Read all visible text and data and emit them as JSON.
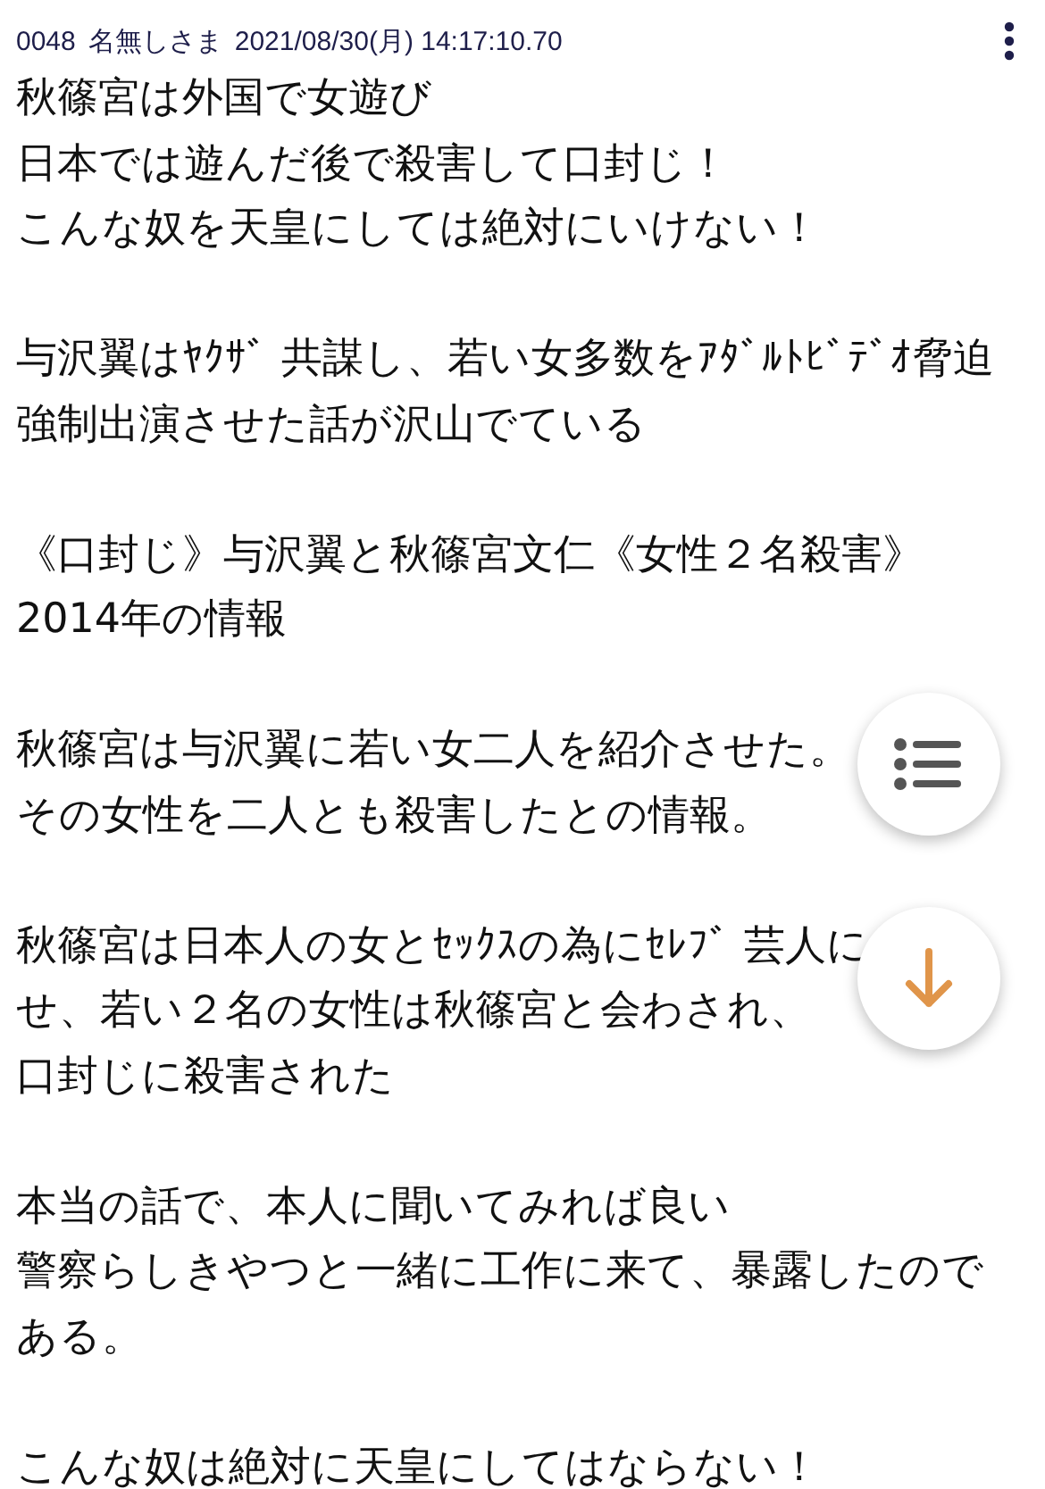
{
  "post": {
    "number": "0048",
    "name": "名無しさま",
    "datetime": "2021/08/30(月) 14:17:10.70",
    "paragraphs": [
      {
        "lines": [
          "秋篠宮は外国で女遊び",
          "日本では遊んだ後で殺害して口封じ！",
          "こんな奴を天皇にしては絶対にいけない！"
        ]
      },
      {
        "lines": [
          "与沢翼はﾔｸｻﾞ 共謀し、若い女多数をｱﾀﾞﾙﾄﾋﾞﾃﾞｵ脅迫",
          "強制出演させた話が沢山でている"
        ]
      },
      {
        "lines": [
          "《口封じ》与沢翼と秋篠宮文仁《女性２名殺害》",
          "2014年の情報"
        ]
      },
      {
        "lines": [
          "秋篠宮は与沢翼に若い女二人を紹介させた。",
          "その女性を二人とも殺害したとの情報。"
        ]
      },
      {
        "lines": [
          "秋篠宮は日本人の女とｾｯｸｽの為にｾﾚﾌﾞ 芸人に",
          "せ、若い２名の女性は秋篠宮と会わされ、",
          "口封じに殺害された"
        ]
      },
      {
        "lines": [
          "本当の話で、本人に聞いてみれば良い",
          "警察らしきやつと一緒に工作に来て、暴露したので",
          "ある。"
        ]
      },
      {
        "lines": [
          "こんな奴は絶対に天皇にしてはならない！"
        ]
      }
    ]
  },
  "fabs": [
    {
      "kind": "menu"
    },
    {
      "kind": "scroll_down"
    }
  ]
}
